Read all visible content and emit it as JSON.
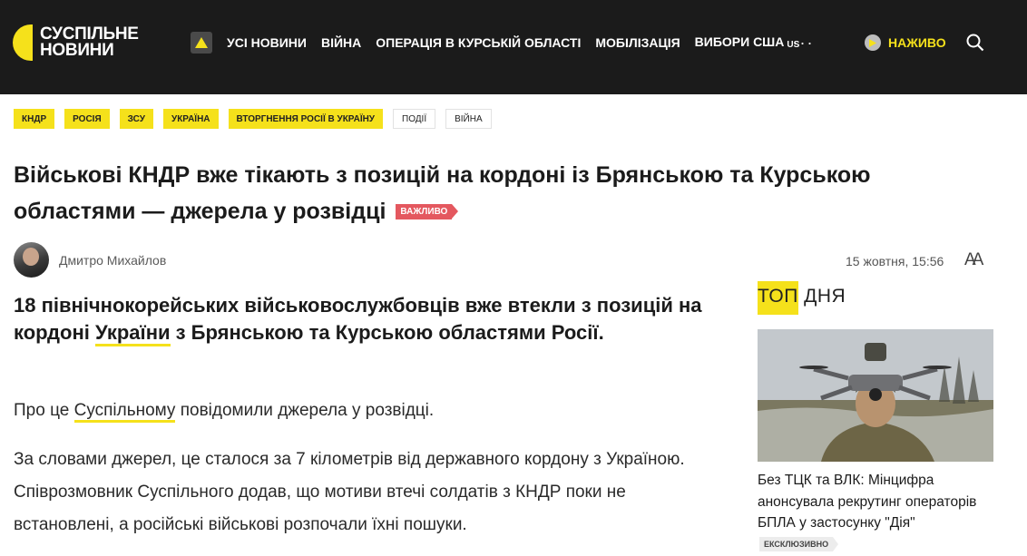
{
  "header": {
    "logo_line1": "СУСПІЛЬНЕ",
    "logo_line2": "НОВИНИ",
    "nav": [
      "Усі новини",
      "Війна",
      "Операція в Курській області",
      "Мобілізація",
      "Вибори США"
    ],
    "nav_sup": "US",
    "more": "...",
    "live_label": "НАЖИВО"
  },
  "tags": [
    {
      "label": "КНДР",
      "style": "yellow"
    },
    {
      "label": "Росія",
      "style": "yellow"
    },
    {
      "label": "ЗСУ",
      "style": "yellow"
    },
    {
      "label": "Україна",
      "style": "yellow"
    },
    {
      "label": "Вторгнення Росії в Україну",
      "style": "yellow"
    },
    {
      "label": "Події",
      "style": "plain"
    },
    {
      "label": "Війна",
      "style": "plain"
    }
  ],
  "article": {
    "title": "Військові КНДР вже тікають з позицій на кордоні із Брянською та Курською областями — джерела у розвідці",
    "badge": "ВАЖЛИВО",
    "author": "Дмитро Михайлов",
    "date": "15 жовтня, 15:56",
    "font_toggle": "AA",
    "lead_before": "18 північнокорейських військовослужбовців вже втекли з позицій на кордоні ",
    "lead_link": "України",
    "lead_after": " з Брянською та Курською областями Росії.",
    "p1_before": "Про це ",
    "p1_link": "Суспільному",
    "p1_after": " повідомили джерела у розвідці.",
    "p2": "За словами джерел, це сталося за 7 кілометрів від державного кордону з Україною. Співрозмовник Суспільного додав, що мотиви втечі солдатів з КНДР поки не встановлені, а російські військові розпочали їхні пошуки."
  },
  "sidebar": {
    "title_hl": "ТОП",
    "title_rest": " ДНЯ",
    "item_title": "Без ТЦК та ВЛК: Мінцифра анонсувала рекрутинг операторів БПЛА у застосунку \"Дія\"",
    "item_badge": "ЕКСКЛЮЗИВНО"
  },
  "colors": {
    "accent": "#f5e11b",
    "header_bg": "#1b1b1b",
    "badge_red": "#e4585f"
  }
}
